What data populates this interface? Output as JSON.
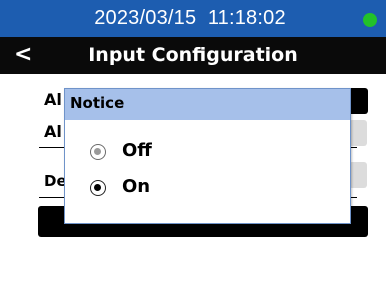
{
  "status_bar": {
    "datetime": "2023/03/15  11:18:02",
    "indicator_color": "#22c22a"
  },
  "header": {
    "back_label": "<",
    "title": "Input Configuration"
  },
  "list": {
    "rows": [
      {
        "label": "Al"
      },
      {
        "label": "Al"
      },
      {
        "label": "De"
      }
    ]
  },
  "dialog": {
    "title": "Notice",
    "options": [
      {
        "label": "Off",
        "selected": false
      },
      {
        "label": "On",
        "selected": true
      }
    ]
  },
  "colors": {
    "status_bar": "#1d5db0",
    "header": "#0a0a0a",
    "dialog_title_bar": "#a6c0ea"
  }
}
